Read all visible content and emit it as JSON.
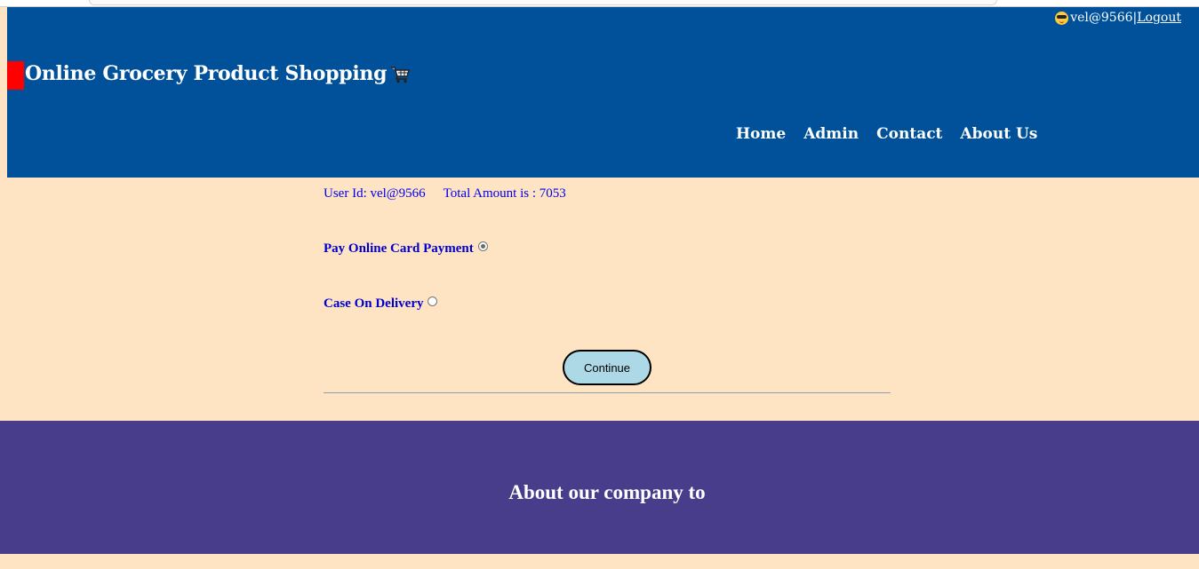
{
  "user_bar": {
    "user": "vel@9566",
    "separator": "|",
    "logout": "Logout"
  },
  "header": {
    "title": "Online Grocery Product Shopping",
    "nav": [
      "Home",
      "Admin",
      "Contact",
      "About Us"
    ]
  },
  "order": {
    "user_label": "User Id: vel@9566",
    "total_label": "Total Amount is : 7053"
  },
  "payment": {
    "option1_label": "Pay Online Card Payment",
    "option1_checked": true,
    "option2_label": "Case On Delivery",
    "option2_checked": false,
    "continue_label": "Continue"
  },
  "footer": {
    "heading": "About our company to"
  },
  "colors": {
    "header_bg": "#00519a",
    "page_bg": "#ffe4c4",
    "footer_bg": "#483d8b",
    "brand_mark": "#ff0000",
    "button_bg": "#add8e6",
    "link_text": "#0000cd"
  },
  "icons": {
    "user": "sunglasses-face-icon",
    "brand": "shopping-cart-icon"
  }
}
